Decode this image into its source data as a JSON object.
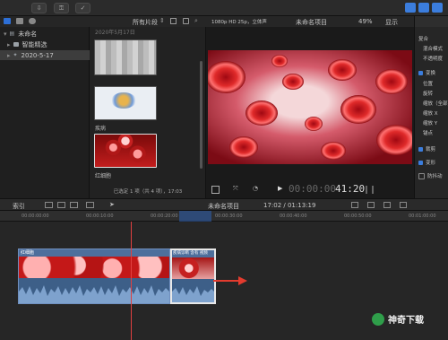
{
  "browser": {
    "filter_label": "所有片段",
    "date_header": "2020年5月17日",
    "clips": [
      {
        "name": ""
      },
      {
        "name": "疾病"
      },
      {
        "name": "红细胞"
      }
    ],
    "selection_status": "已选定 1 项（共 4 项），17:03"
  },
  "library": {
    "items": [
      {
        "label": "未命名",
        "type": "library"
      },
      {
        "label": "智能精选",
        "type": "smart-collection"
      },
      {
        "label": "2020-5-17",
        "type": "event"
      }
    ]
  },
  "viewer": {
    "format": "1080p HD 25p，立体声",
    "project_name": "未命名项目",
    "zoom": "49%",
    "view_menu": "显示",
    "timecode_prefix": "00:00:00",
    "timecode": "41:20"
  },
  "inspector": {
    "items": [
      {
        "label": "复合",
        "checkbox": "none"
      },
      {
        "label": "混合模式",
        "checkbox": "none"
      },
      {
        "label": "不透明度",
        "checkbox": "none"
      },
      {
        "label": "变换",
        "checkbox": "checked"
      },
      {
        "label": "位置",
        "checkbox": "none"
      },
      {
        "label": "旋转",
        "checkbox": "none"
      },
      {
        "label": "缩放（全部）",
        "checkbox": "none"
      },
      {
        "label": "缩放 X",
        "checkbox": "none"
      },
      {
        "label": "缩放 Y",
        "checkbox": "none"
      },
      {
        "label": "锚点",
        "checkbox": "none"
      },
      {
        "label": "裁剪",
        "checkbox": "checked"
      },
      {
        "label": "变形",
        "checkbox": "checked"
      },
      {
        "label": "防抖动",
        "checkbox": "unchecked"
      }
    ]
  },
  "timeline": {
    "index_label": "索引",
    "project_name": "未命名项目",
    "duration": "17:02 / 01:13:19",
    "ruler_marks": [
      "00:00:00:00",
      "00:00:10:00",
      "00:00:20:00",
      "00:00:30:00",
      "00:00:40:00",
      "00:00:50:00",
      "00:01:00:00"
    ],
    "clips": [
      {
        "name": "红细胞"
      },
      {
        "name": "疾病诊断 含有 视频"
      }
    ]
  },
  "watermark": {
    "text": "神奇下载"
  },
  "colors": {
    "accent": "#3b7ddd",
    "playhead": "#e04040",
    "arrow": "#e33b2e",
    "clip_audio": "#3d5f88"
  }
}
